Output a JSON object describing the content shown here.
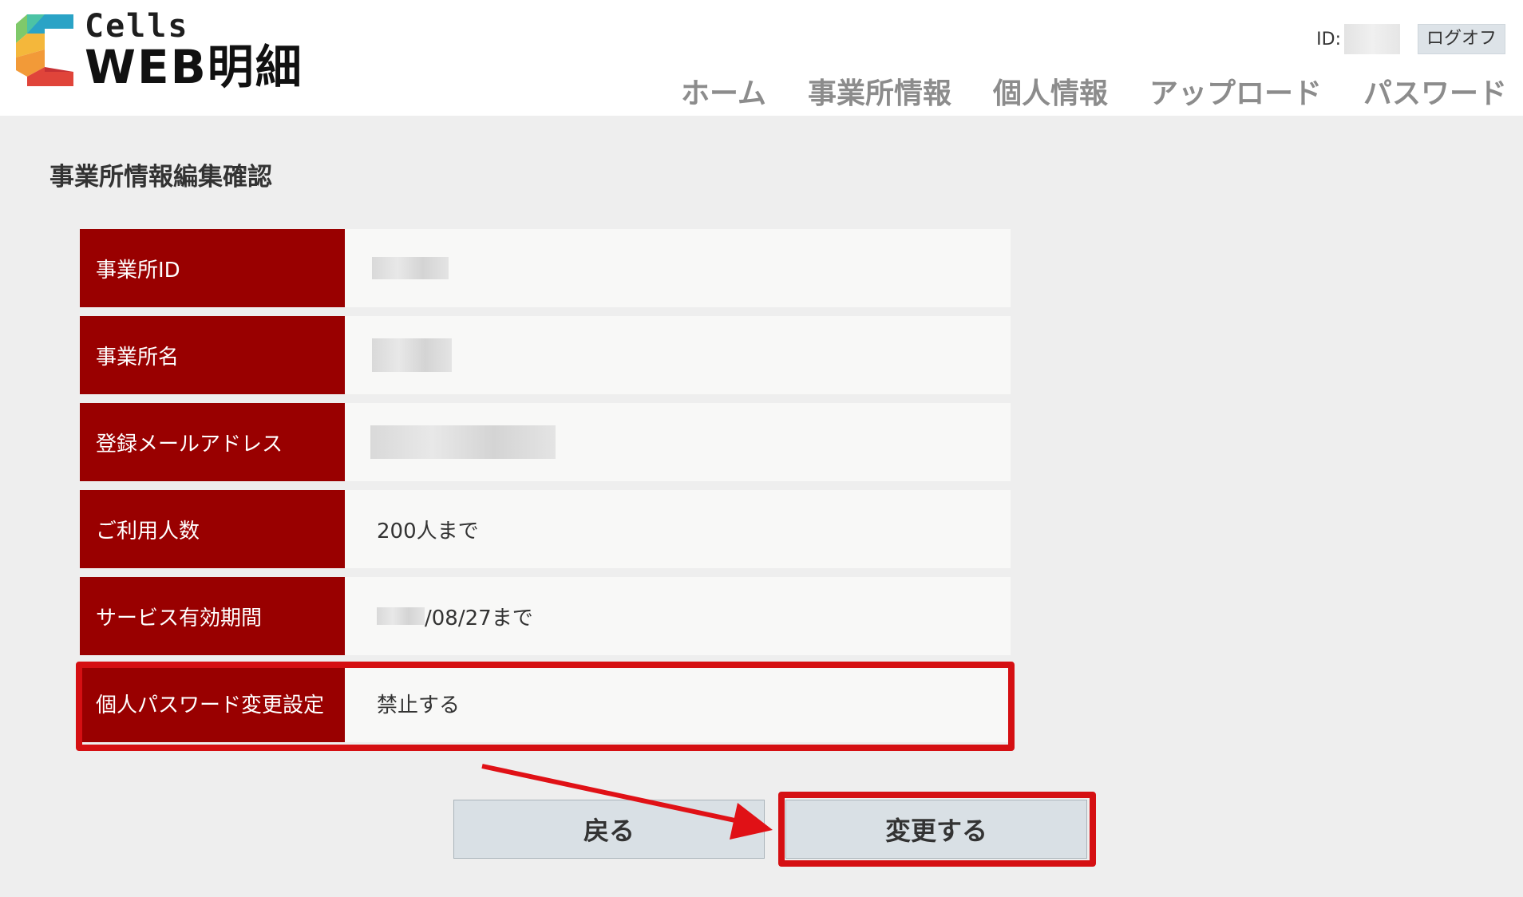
{
  "app": {
    "brand_top": "Cells",
    "brand_main": "WEB明細"
  },
  "user": {
    "id_label": "ID:",
    "logoff_label": "ログオフ"
  },
  "nav": {
    "items": [
      "ホーム",
      "事業所情報",
      "個人情報",
      "アップロード",
      "パスワード"
    ]
  },
  "page": {
    "title": "事業所情報編集確認"
  },
  "fields": [
    {
      "label": "事業所ID",
      "value": ""
    },
    {
      "label": "事業所名",
      "value": ""
    },
    {
      "label": "登録メールアドレス",
      "value": ""
    },
    {
      "label": "ご利用人数",
      "value": "200人まで"
    },
    {
      "label": "サービス有効期間",
      "value": "/08/27まで"
    },
    {
      "label": "個人パスワード変更設定",
      "value": "禁止する"
    }
  ],
  "buttons": {
    "back_label": "戻る",
    "change_label": "変更する"
  },
  "colors": {
    "label_bg": "#990000",
    "highlight": "#d50f12",
    "button_bg": "#d9e0e5"
  }
}
